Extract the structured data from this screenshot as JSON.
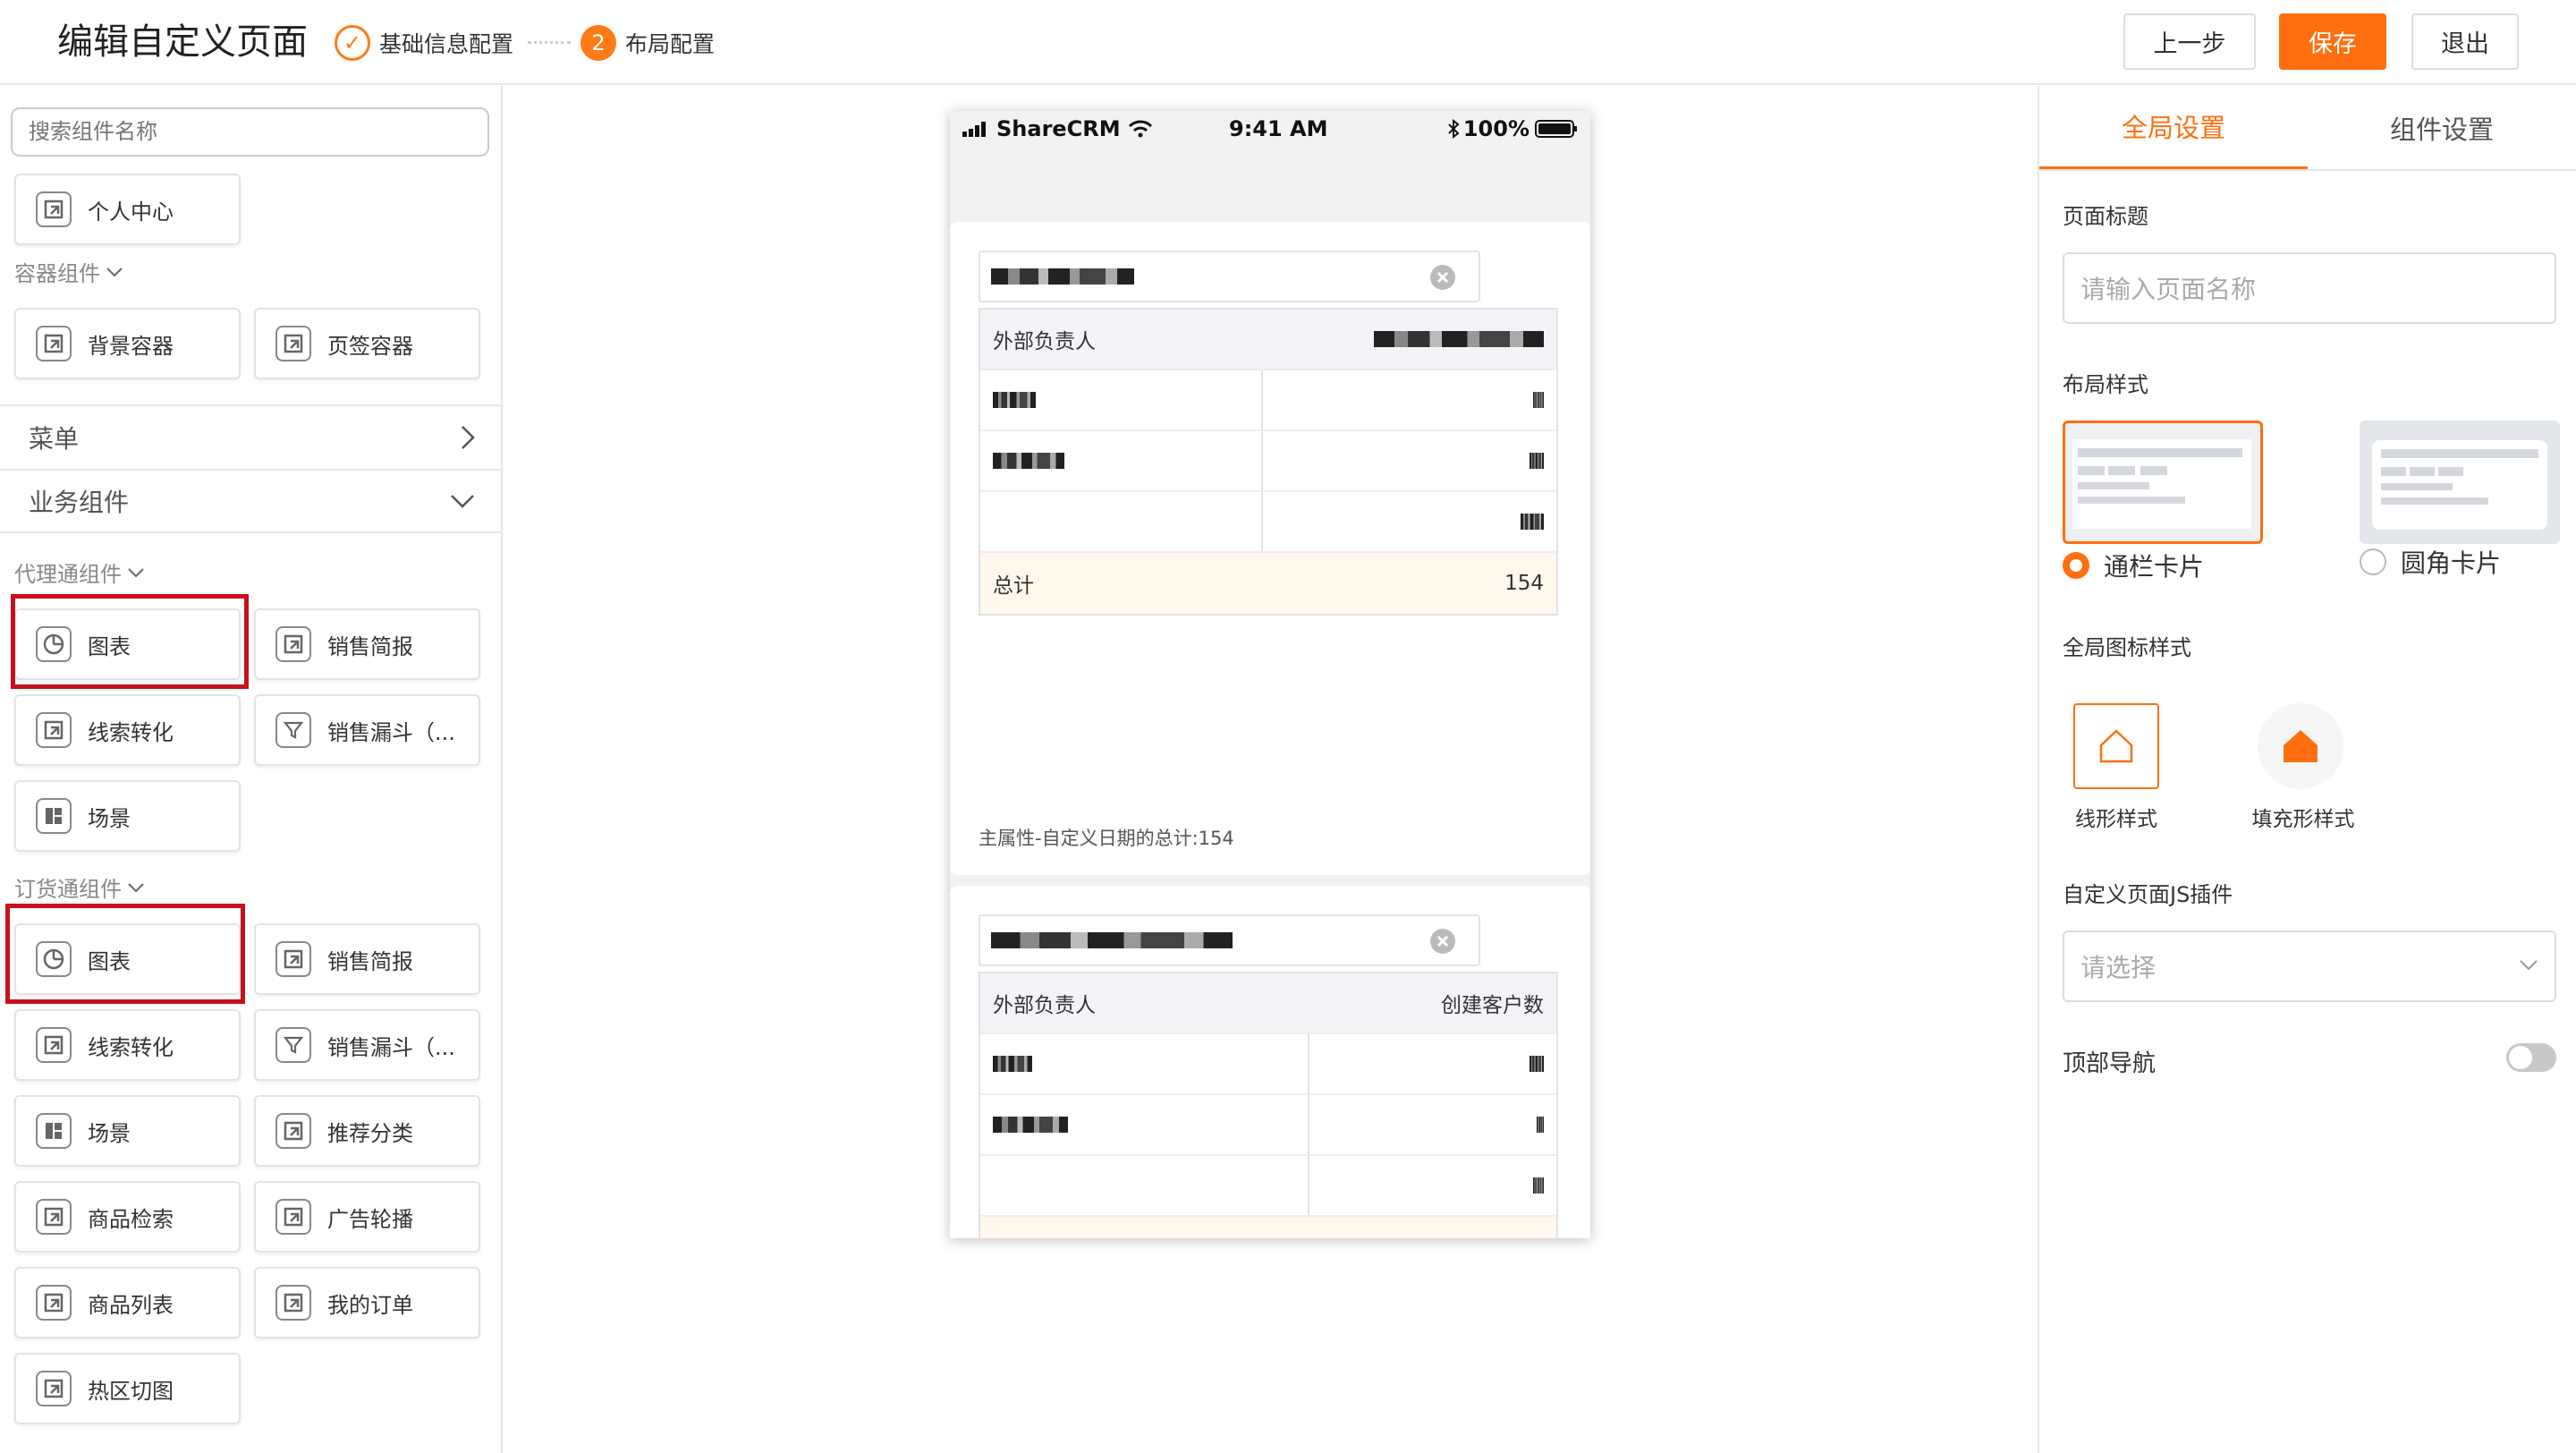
{
  "header": {
    "title": "编辑自定义页面",
    "steps": [
      {
        "label": "基础信息配置",
        "state": "done"
      },
      {
        "label": "布局配置",
        "number": "2",
        "state": "active"
      }
    ],
    "buttons": {
      "prev": "上一步",
      "save": "保存",
      "exit": "退出"
    }
  },
  "left": {
    "search_placeholder": "搜索组件名称",
    "personal_center": "个人中心",
    "container_section": "容器组件",
    "container_items": [
      "背景容器",
      "页签容器"
    ],
    "menu_accordion": "菜单",
    "business_accordion": "业务组件",
    "agent_section": "代理通组件",
    "agent_items": [
      "图表",
      "销售简报",
      "线索转化",
      "销售漏斗（...",
      "场景"
    ],
    "order_section": "订货通组件",
    "order_items": [
      "图表",
      "销售简报",
      "线索转化",
      "销售漏斗（...",
      "场景",
      "推荐分类",
      "商品检索",
      "广告轮播",
      "商品列表",
      "我的订单",
      "热区切图"
    ]
  },
  "phone": {
    "carrier": "ShareCRM",
    "time": "9:41 AM",
    "battery": "100%",
    "card1": {
      "col1_header": "外部负责人",
      "total_label": "总计",
      "total_value": "154",
      "summary": "主属性-自定义日期的总计:154"
    },
    "card2": {
      "col1_header": "外部负责人",
      "col2_header": "创建客户数"
    }
  },
  "right": {
    "tabs": [
      "全局设置",
      "组件设置"
    ],
    "page_title_label": "页面标题",
    "page_title_placeholder": "请输入页面名称",
    "layout_label": "布局样式",
    "layout_options": [
      {
        "label": "通栏卡片",
        "selected": true
      },
      {
        "label": "圆角卡片",
        "selected": false
      }
    ],
    "icon_style_label": "全局图标样式",
    "icon_styles": [
      "线形样式",
      "填充形样式"
    ],
    "js_plugin_label": "自定义页面JS插件",
    "js_plugin_placeholder": "请选择",
    "top_nav_label": "顶部导航",
    "top_nav_enabled": false
  },
  "colors": {
    "accent": "#ff6f0f",
    "highlight": "#c8101d"
  }
}
